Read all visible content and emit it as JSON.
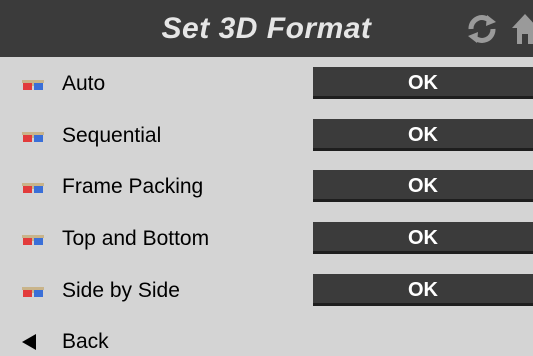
{
  "header": {
    "title": "Set 3D Format"
  },
  "icons": {
    "row_icon": "3d-glasses-icon",
    "refresh": "refresh-icon",
    "home": "home-icon",
    "back": "back-arrow-icon"
  },
  "rows": [
    {
      "label": "Auto",
      "button": "OK"
    },
    {
      "label": "Sequential",
      "button": "OK"
    },
    {
      "label": "Frame Packing",
      "button": "OK"
    },
    {
      "label": "Top and Bottom",
      "button": "OK"
    },
    {
      "label": "Side by Side",
      "button": "OK"
    }
  ],
  "back": {
    "label": "Back"
  },
  "colors": {
    "header_bg": "#3b3b3b",
    "body_bg": "#d4d4d4",
    "button_bg": "#3b3b3b",
    "button_text": "#ffffff",
    "title_text": "#e6e6e6"
  }
}
